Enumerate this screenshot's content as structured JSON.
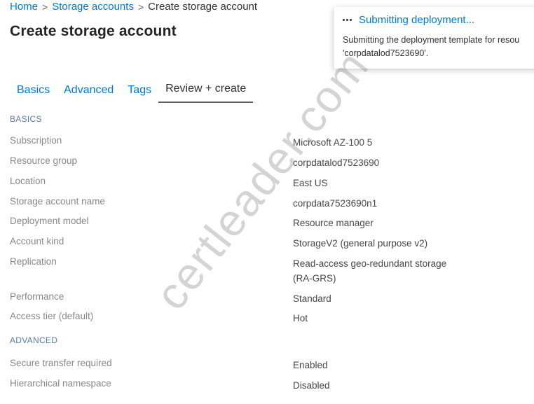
{
  "breadcrumb": {
    "items": [
      "Home",
      "Storage accounts",
      "Create storage account"
    ],
    "separator": ">"
  },
  "page": {
    "title": "Create storage account"
  },
  "tabs": [
    {
      "label": "Basics",
      "active": false
    },
    {
      "label": "Advanced",
      "active": false
    },
    {
      "label": "Tags",
      "active": false
    },
    {
      "label": "Review + create",
      "active": true
    }
  ],
  "sections": {
    "basics": {
      "header": "BASICS",
      "rows": [
        {
          "label": "Subscription",
          "value": "Microsoft AZ-100 5"
        },
        {
          "label": "Resource group",
          "value": "corpdatalod7523690"
        },
        {
          "label": "Location",
          "value": "East US"
        },
        {
          "label": "Storage account name",
          "value": "corpdata7523690n1"
        },
        {
          "label": "Deployment model",
          "value": "Resource manager"
        },
        {
          "label": "Account kind",
          "value": "StorageV2 (general purpose v2)"
        },
        {
          "label": "Replication",
          "value": "Read-access geo-redundant storage (RA-GRS)"
        },
        {
          "label": "Performance",
          "value": "Standard"
        },
        {
          "label": "Access tier (default)",
          "value": "Hot"
        }
      ]
    },
    "advanced": {
      "header": "ADVANCED",
      "rows": [
        {
          "label": "Secure transfer required",
          "value": "Enabled"
        },
        {
          "label": "Hierarchical namespace",
          "value": "Disabled"
        }
      ]
    }
  },
  "notification": {
    "icon": "ellipsis-progress-icon",
    "title": "Submitting deployment...",
    "body": "Submitting the deployment template for resou\n'corpdatalod7523690'."
  },
  "watermark": {
    "text": "certleader.com"
  },
  "colors": {
    "link": "#0078d4",
    "section_header": "#5a7ba8",
    "label": "#8a8886",
    "value": "#484644"
  }
}
